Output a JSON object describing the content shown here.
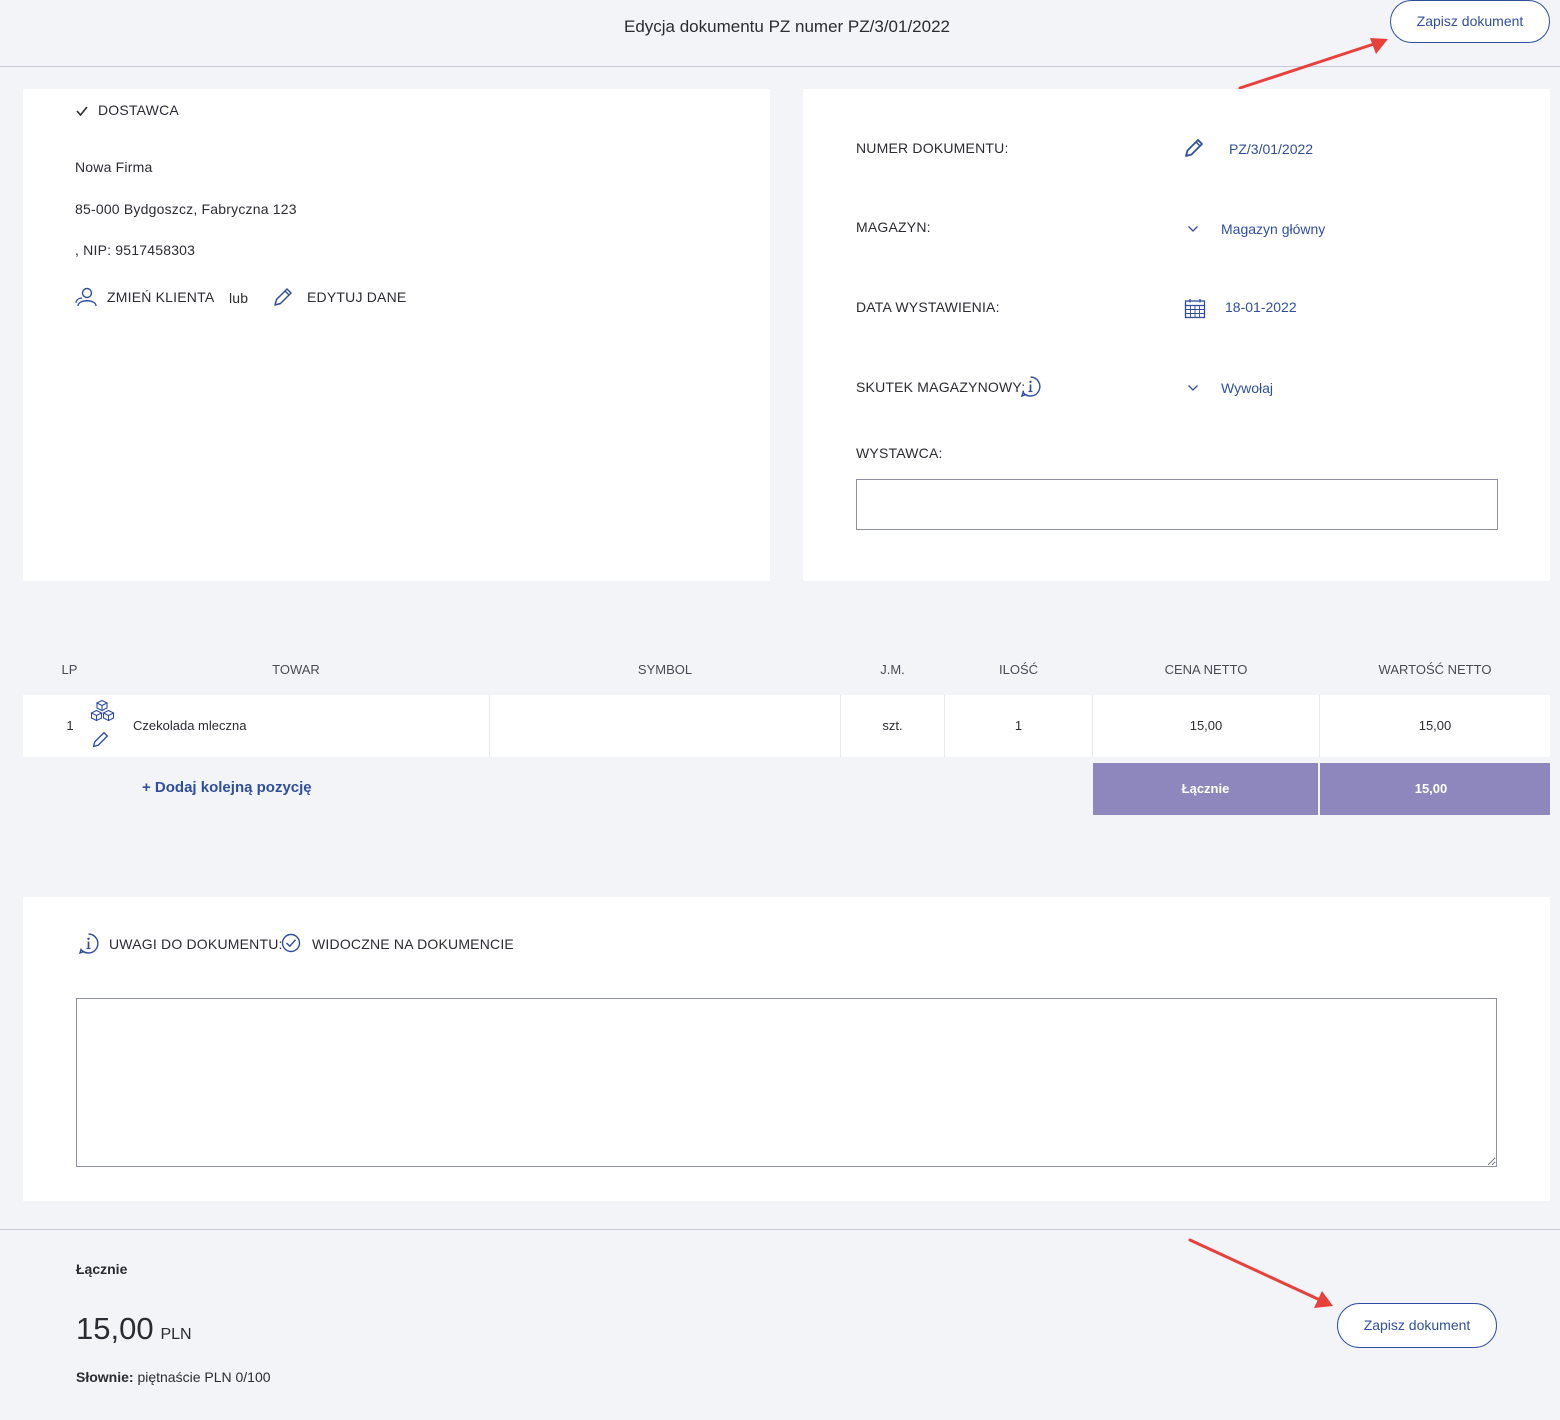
{
  "header": {
    "title": "Edycja dokumentu PZ numer PZ/3/01/2022",
    "save_label": "Zapisz dokument"
  },
  "supplier": {
    "heading": "DOSTAWCA",
    "name": "Nowa Firma",
    "address": "85-000 Bydgoszcz, Fabryczna 123",
    "nip": ", NIP: 9517458303",
    "change_client": "ZMIEŃ KLIENTA",
    "or": "lub",
    "edit_data": "EDYTUJ DANE"
  },
  "details": {
    "number_label": "NUMER DOKUMENTU:",
    "number_value": "PZ/3/01/2022",
    "warehouse_label": "MAGAZYN:",
    "warehouse_value": "Magazyn główny",
    "date_label": "DATA WYSTAWIENIA:",
    "date_value": "18-01-2022",
    "effect_label": "SKUTEK MAGAZYNOWY:",
    "effect_value": "Wywołaj",
    "issuer_label": "WYSTAWCA:",
    "issuer_value": ""
  },
  "table": {
    "headers": {
      "lp": "LP",
      "item": "TOWAR",
      "symbol": "SYMBOL",
      "unit": "J.M.",
      "qty": "ILOŚĆ",
      "net_price": "CENA NETTO",
      "net_value": "WARTOŚĆ NETTO"
    },
    "rows": [
      {
        "lp": "1",
        "item": "Czekolada mleczna",
        "symbol": "",
        "unit": "szt.",
        "qty": "1",
        "net_price": "15,00",
        "net_value": "15,00"
      }
    ],
    "add_position": "+ Dodaj kolejną pozycję",
    "total_label": "Łącznie",
    "total_value": "15,00"
  },
  "notes": {
    "label": "UWAGI DO DOKUMENTU:",
    "visible_label": "WIDOCZNE NA DOKUMENCIE",
    "value": ""
  },
  "summary": {
    "label": "Łącznie",
    "amount": "15,00",
    "currency": "PLN",
    "words_label": "Słownie:",
    "words_value": " piętnaście PLN 0/100"
  },
  "colors": {
    "accent": "#2f4f9e",
    "total_bg": "#8d87bd",
    "arrow": "#e8413c"
  }
}
